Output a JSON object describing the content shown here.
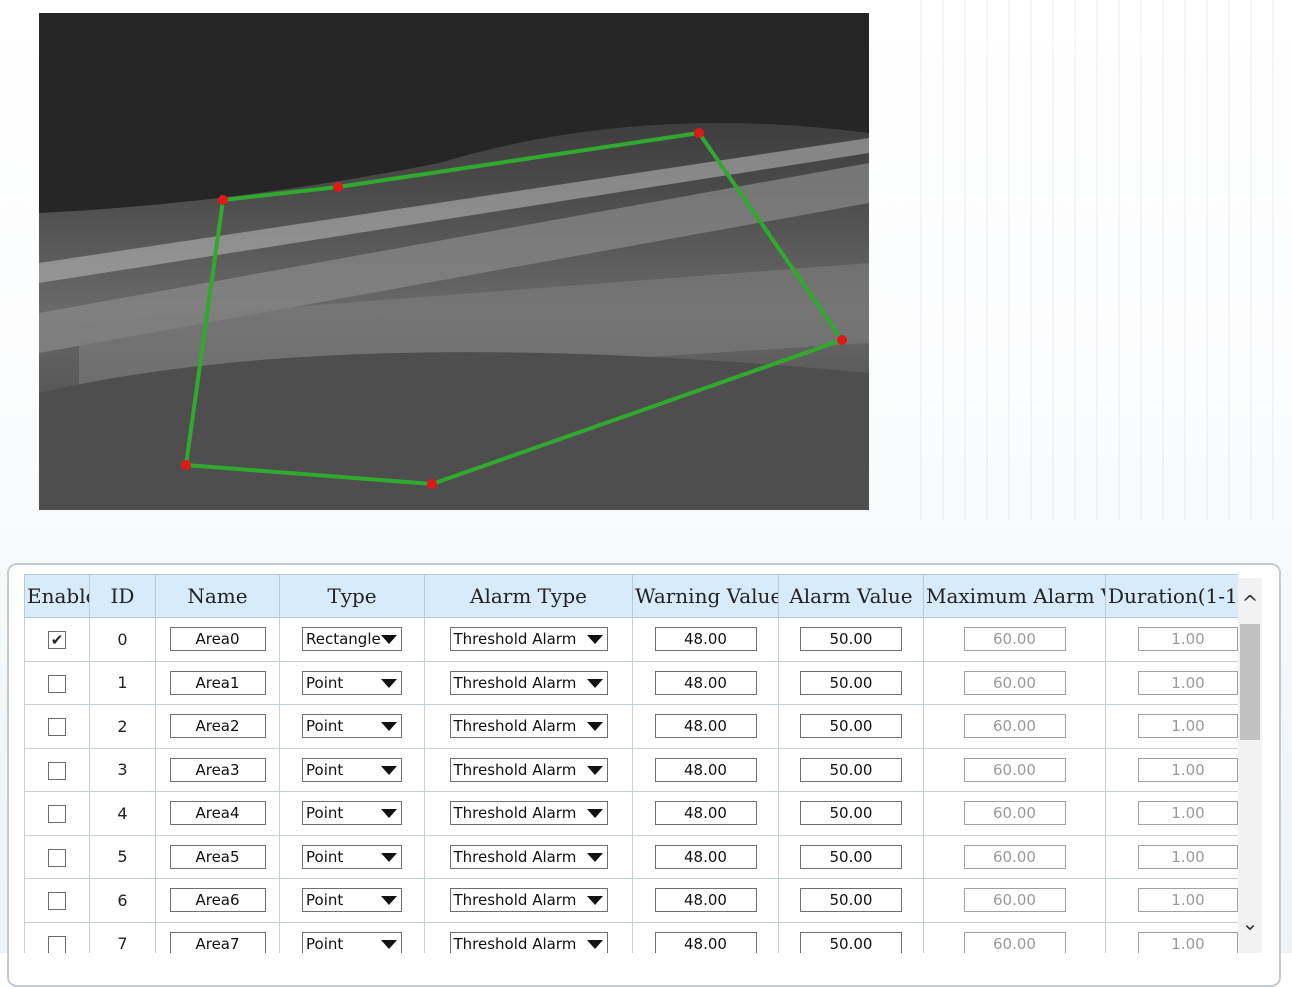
{
  "preview": {
    "description_icon": "thermal-camera-view",
    "polygon_color": "#2faa2f",
    "vertex_color": "#e01818"
  },
  "table": {
    "headers": {
      "enable": "Enable",
      "id": "ID",
      "name": "Name",
      "type": "Type",
      "alarm_type": "Alarm Type",
      "warning_value": "Warning Value",
      "alarm_value": "Alarm Value",
      "max_alarm_value": "Maximum Alarm Va",
      "duration": "Duration(1-1"
    },
    "rows": [
      {
        "enabled": "✔",
        "id": "0",
        "name": "Area0",
        "type": "Rectangle",
        "alarm_type": "Threshold Alarm",
        "warning": "48.00",
        "alarm": "50.00",
        "max": "60.00",
        "duration": "1.00"
      },
      {
        "enabled": "",
        "id": "1",
        "name": "Area1",
        "type": "Point",
        "alarm_type": "Threshold Alarm",
        "warning": "48.00",
        "alarm": "50.00",
        "max": "60.00",
        "duration": "1.00"
      },
      {
        "enabled": "",
        "id": "2",
        "name": "Area2",
        "type": "Point",
        "alarm_type": "Threshold Alarm",
        "warning": "48.00",
        "alarm": "50.00",
        "max": "60.00",
        "duration": "1.00"
      },
      {
        "enabled": "",
        "id": "3",
        "name": "Area3",
        "type": "Point",
        "alarm_type": "Threshold Alarm",
        "warning": "48.00",
        "alarm": "50.00",
        "max": "60.00",
        "duration": "1.00"
      },
      {
        "enabled": "",
        "id": "4",
        "name": "Area4",
        "type": "Point",
        "alarm_type": "Threshold Alarm",
        "warning": "48.00",
        "alarm": "50.00",
        "max": "60.00",
        "duration": "1.00"
      },
      {
        "enabled": "",
        "id": "5",
        "name": "Area5",
        "type": "Point",
        "alarm_type": "Threshold Alarm",
        "warning": "48.00",
        "alarm": "50.00",
        "max": "60.00",
        "duration": "1.00"
      },
      {
        "enabled": "",
        "id": "6",
        "name": "Area6",
        "type": "Point",
        "alarm_type": "Threshold Alarm",
        "warning": "48.00",
        "alarm": "50.00",
        "max": "60.00",
        "duration": "1.00"
      },
      {
        "enabled": "",
        "id": "7",
        "name": "Area7",
        "type": "Point",
        "alarm_type": "Threshold Alarm",
        "warning": "48.00",
        "alarm": "50.00",
        "max": "60.00",
        "duration": "1.00"
      }
    ]
  },
  "scrollbar": {
    "up_icon": "chevron-up-icon",
    "down_icon": "chevron-down-icon",
    "up_glyph": "^",
    "down_glyph": "⌄"
  }
}
